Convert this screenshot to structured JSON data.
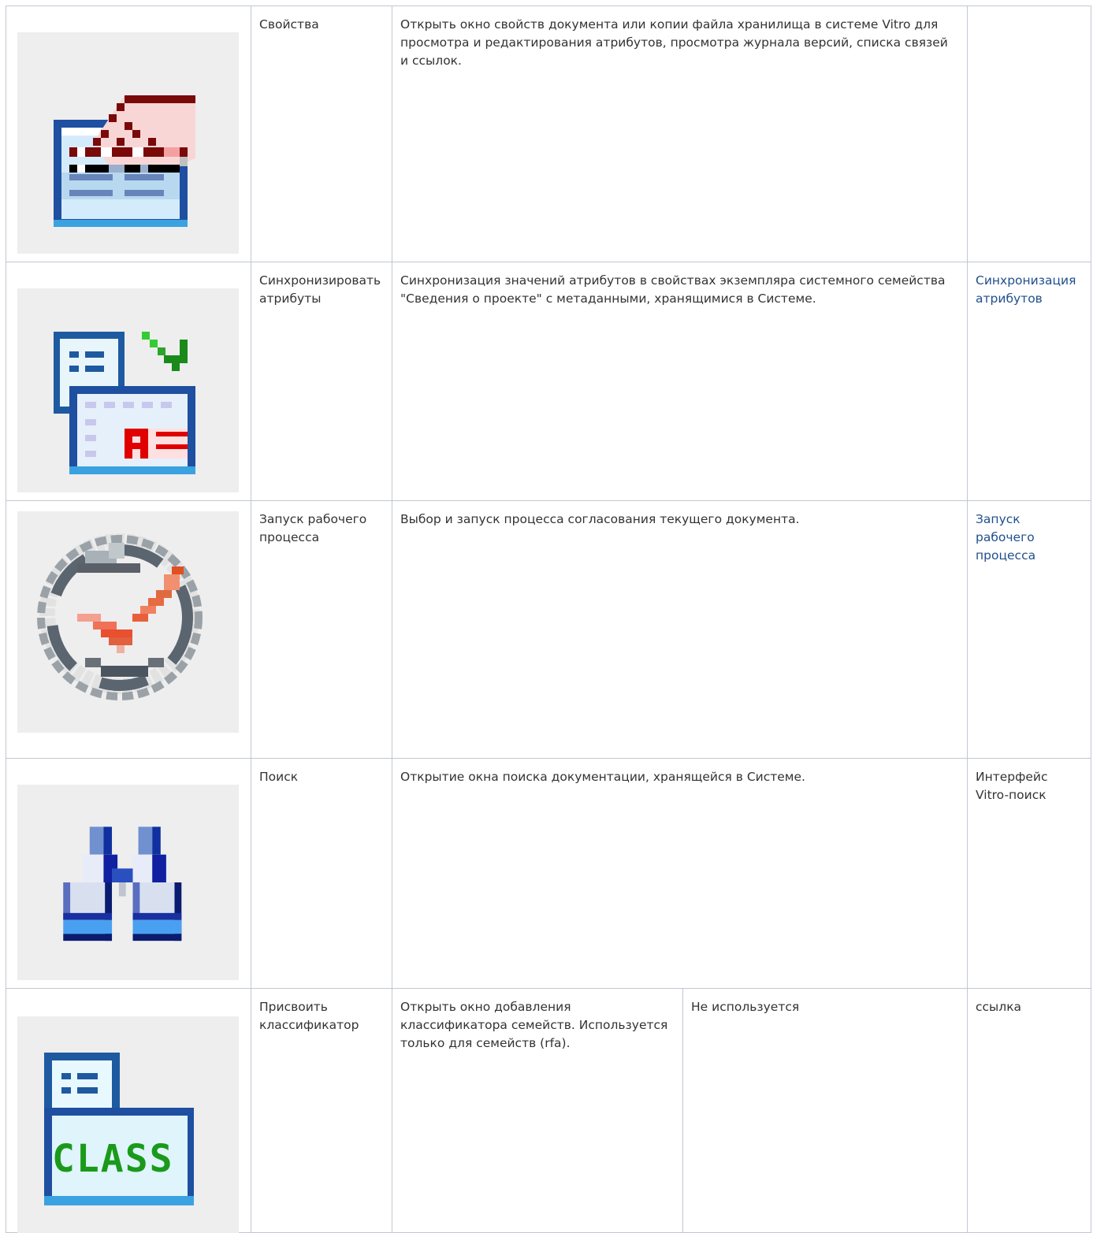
{
  "rows": [
    {
      "icon": "properties-icon",
      "name": "Свойства",
      "description": "Открыть окно свойств документа или копии файла хранилища в системе Vitro для просмотра и редактирования атрибутов, просмотра журнала версий, списка связей и ссылок.",
      "link": ""
    },
    {
      "icon": "sync-attributes-icon",
      "name": "Синхронизировать атрибуты",
      "description": "Синхронизация значений атрибутов в свойствах экземпляра системного семейства \"Сведения о проекте\" с метаданными, хранящимися в Системе.",
      "link": "Синхронизация атрибутов"
    },
    {
      "icon": "workflow-start-icon",
      "name": "Запуск рабочего процесса",
      "description": "Выбор и запуск процесса согласования текущего документа.",
      "link": "Запуск рабочего процесса"
    },
    {
      "icon": "binoculars-search-icon",
      "name": "Поиск",
      "description": "Открытие окна поиска документации, хранящейся в Системе.",
      "link": "Интерфейс Vitro-поиск"
    },
    {
      "icon": "classifier-icon",
      "name": "Присвоить классификатор",
      "description": "Открыть окно добавления классификатора семейств. Используется только для семейств (rfa).",
      "note": "Не используется",
      "link": "ссылка",
      "icon_text": "CLASS"
    }
  ],
  "colors": {
    "border": "#c1c7d0",
    "icon_background": "#eeeeee",
    "link": "#1f4e8c",
    "text": "#333333"
  }
}
